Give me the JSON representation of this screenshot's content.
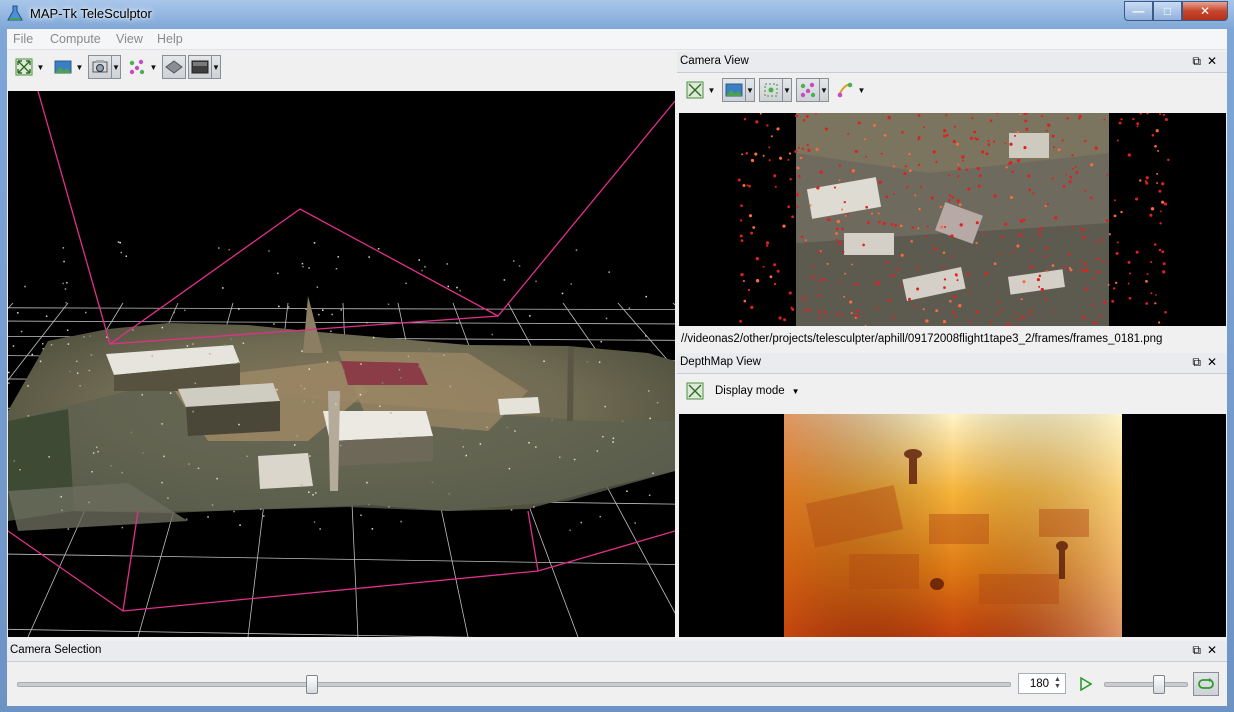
{
  "window": {
    "title": "MAP-Tk TeleSculptor",
    "min_glyph": "—",
    "max_glyph": "□",
    "close_glyph": "✕"
  },
  "menu": [
    "File",
    "Compute",
    "View",
    "Help"
  ],
  "camera_view": {
    "title": "Camera View",
    "frame_path": "//videonas2/other/projects/telesculpter/aphill/09172008flight1tape3_2/frames/frames_0181.png"
  },
  "depthmap_view": {
    "title": "DepthMap View",
    "display_mode_label": "Display mode"
  },
  "camera_selection": {
    "title": "Camera Selection",
    "frame_value": "180",
    "slider_level": 0.295,
    "speed_level": 0.65
  },
  "dock_controls": {
    "float_glyph": "⧉",
    "close_glyph": "✕"
  },
  "colors": {
    "camera_frustum": "#e0308a",
    "grid": "#bfbfbf",
    "accent": "#4a8f3c"
  }
}
